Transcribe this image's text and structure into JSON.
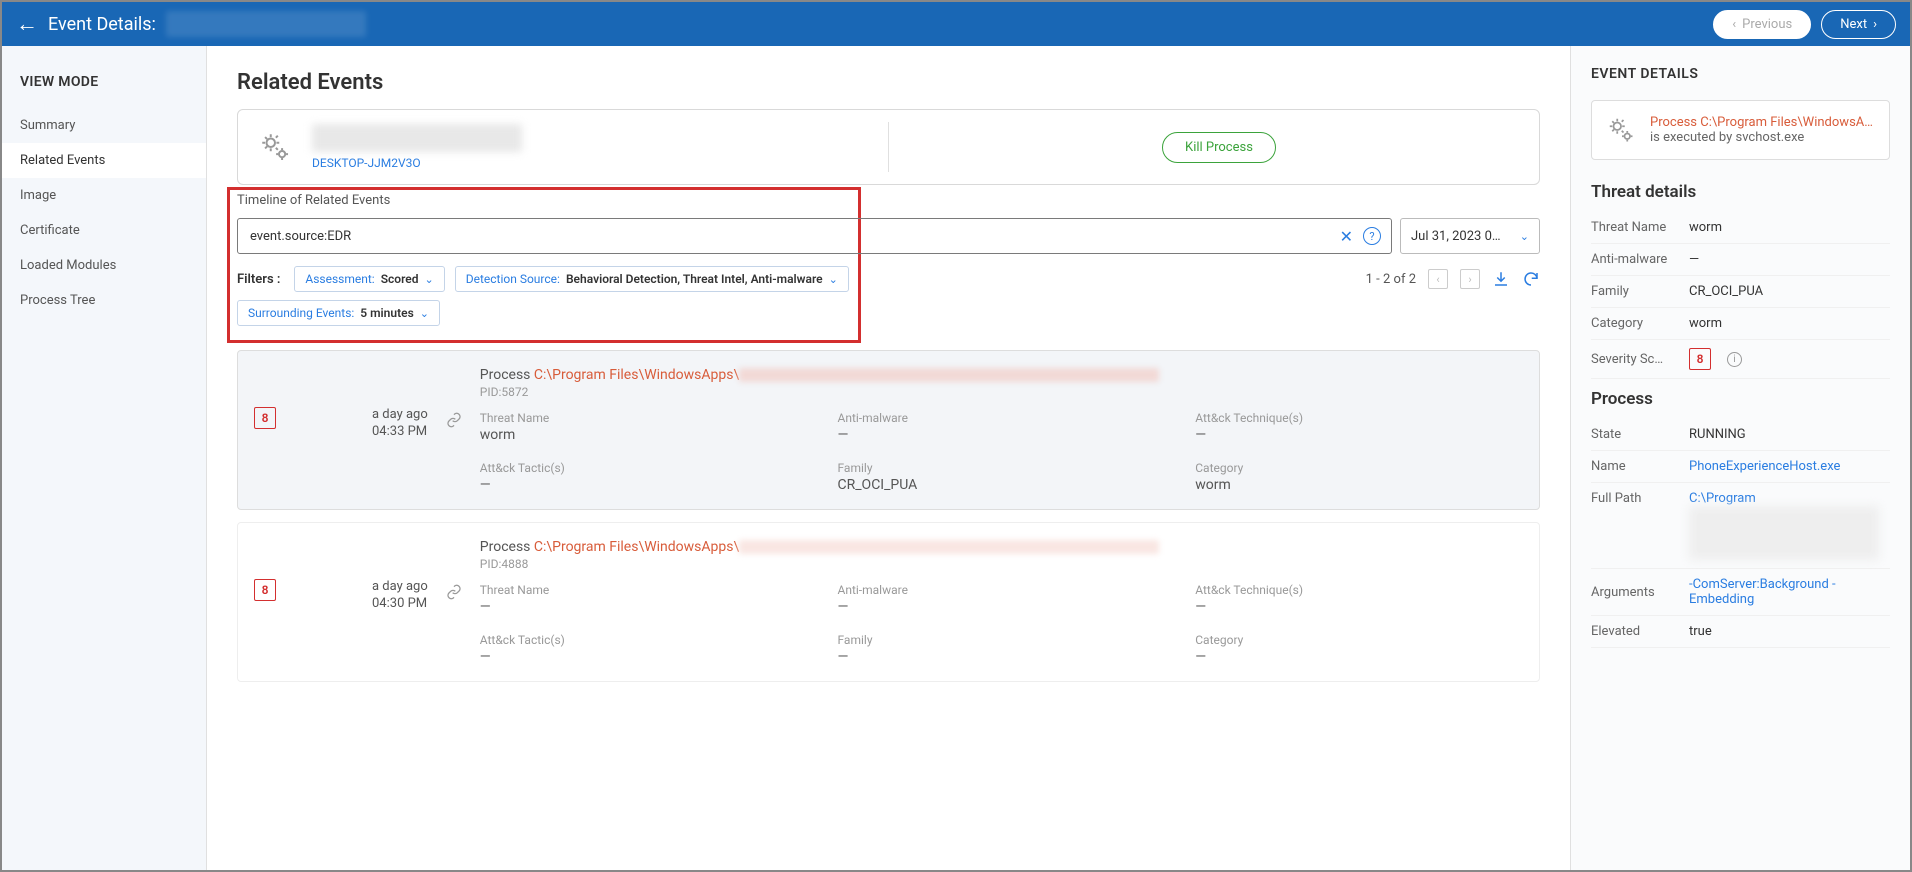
{
  "topbar": {
    "title": "Event Details:",
    "prev": "Previous",
    "next": "Next"
  },
  "sidebar": {
    "heading": "VIEW MODE",
    "items": [
      "Summary",
      "Related Events",
      "Image",
      "Certificate",
      "Loaded Modules",
      "Process Tree"
    ]
  },
  "page": {
    "title": "Related Events",
    "host_link": "DESKTOP-JJM2V3O",
    "kill_btn": "Kill Process",
    "timeline_title": "Timeline of Related Events",
    "search_value": "event.source:EDR",
    "date_value": "Jul 31, 2023 0…",
    "filters_label": "Filters :",
    "pager": "1 - 2 of  2"
  },
  "chips": [
    {
      "k": "Assessment:",
      "v": " Scored"
    },
    {
      "k": "Detection Source:",
      "v": " Behavioral Detection, Threat Intel, Anti-malware"
    },
    {
      "k": "Surrounding Events:",
      "v": " 5 minutes"
    }
  ],
  "events": [
    {
      "sev": "8",
      "ago": "a day ago",
      "time": "04:33 PM",
      "proc_label": "Process ",
      "path": "C:\\Program Files\\WindowsApps\\",
      "pid": "PID:5872",
      "fields": {
        "threat_name_l": "Threat Name",
        "threat_name_v": "worm",
        "antimalware_l": "Anti-malware",
        "antimalware_v": "—",
        "attck_tech_l": "Att&ck Technique(s)",
        "attck_tech_v": "—",
        "attck_tac_l": "Att&ck Tactic(s)",
        "attck_tac_v": "—",
        "family_l": "Family",
        "family_v": "CR_OCI_PUA",
        "category_l": "Category",
        "category_v": "worm"
      }
    },
    {
      "sev": "8",
      "ago": "a day ago",
      "time": "04:30 PM",
      "proc_label": "Process ",
      "path": "C:\\Program Files\\WindowsApps\\",
      "pid": "PID:4888",
      "fields": {
        "threat_name_l": "Threat Name",
        "threat_name_v": "—",
        "antimalware_l": "Anti-malware",
        "antimalware_v": "—",
        "attck_tech_l": "Att&ck Technique(s)",
        "attck_tech_v": "—",
        "attck_tac_l": "Att&ck Tactic(s)",
        "attck_tac_v": "—",
        "family_l": "Family",
        "family_v": "—",
        "category_l": "Category",
        "category_v": "—"
      }
    }
  ],
  "rpanel": {
    "title": "EVENT DETAILS",
    "alert_l1": "Process C:\\Program Files\\WindowsA…",
    "alert_l2": "is executed by svchost.exe",
    "threat_h": "Threat details",
    "threat": {
      "name_l": "Threat Name",
      "name_v": "worm",
      "am_l": "Anti-malware",
      "am_v": "—",
      "fam_l": "Family",
      "fam_v": "CR_OCI_PUA",
      "cat_l": "Category",
      "cat_v": "worm",
      "sev_l": "Severity Sc…",
      "sev_v": "8"
    },
    "process_h": "Process",
    "process": {
      "state_l": "State",
      "state_v": "RUNNING",
      "name_l": "Name",
      "name_v": "PhoneExperienceHost.exe",
      "path_l": "Full Path",
      "path_v": "C:\\Program",
      "args_l": "Arguments",
      "args_v": "-ComServer:Background -Embedding",
      "elev_l": "Elevated",
      "elev_v": "true"
    }
  }
}
